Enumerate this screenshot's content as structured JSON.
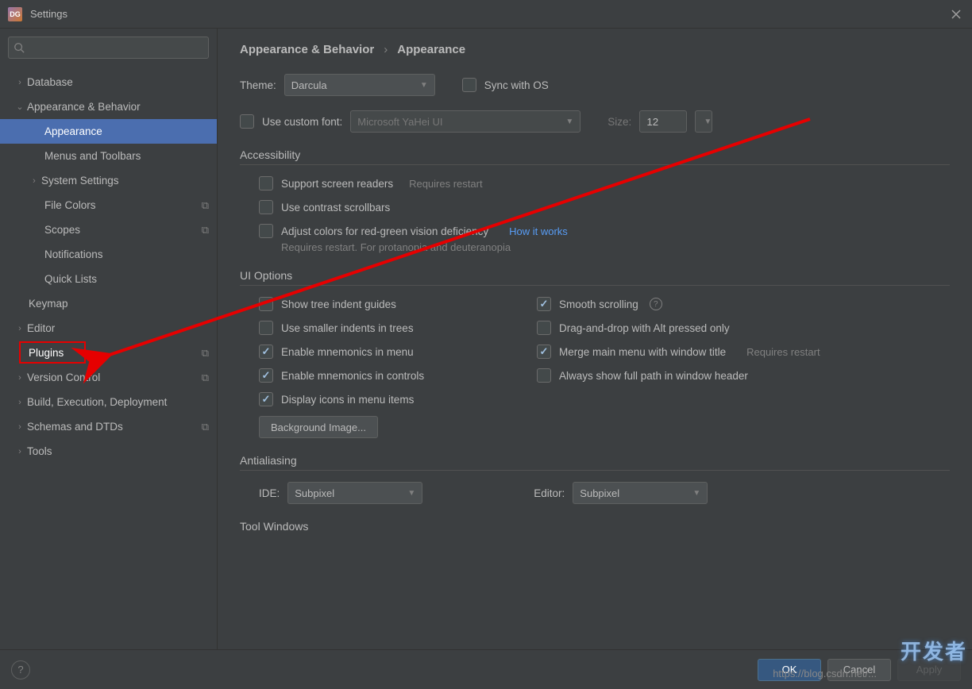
{
  "window": {
    "title": "Settings"
  },
  "sidebar": {
    "search_placeholder": "",
    "items": [
      {
        "label": "Database",
        "level": 0,
        "arrow": "›"
      },
      {
        "label": "Appearance & Behavior",
        "level": 0,
        "arrow": "⌄"
      },
      {
        "label": "Appearance",
        "level": 2,
        "selected": true
      },
      {
        "label": "Menus and Toolbars",
        "level": 2
      },
      {
        "label": "System Settings",
        "level": 1,
        "arrow": "›"
      },
      {
        "label": "File Colors",
        "level": 2,
        "badge": "⧉"
      },
      {
        "label": "Scopes",
        "level": 2,
        "badge": "⧉"
      },
      {
        "label": "Notifications",
        "level": 2
      },
      {
        "label": "Quick Lists",
        "level": 2
      },
      {
        "label": "Keymap",
        "level": 0
      },
      {
        "label": "Editor",
        "level": 0,
        "arrow": "›"
      },
      {
        "label": "Plugins",
        "level": 0,
        "badge": "⧉",
        "highlighted": true
      },
      {
        "label": "Version Control",
        "level": 0,
        "arrow": "›",
        "badge": "⧉"
      },
      {
        "label": "Build, Execution, Deployment",
        "level": 0,
        "arrow": "›"
      },
      {
        "label": "Schemas and DTDs",
        "level": 0,
        "arrow": "›",
        "badge": "⧉"
      },
      {
        "label": "Tools",
        "level": 0,
        "arrow": "›"
      }
    ]
  },
  "breadcrumb": {
    "root": "Appearance & Behavior",
    "sep": "›",
    "leaf": "Appearance"
  },
  "theme": {
    "label": "Theme:",
    "value": "Darcula",
    "sync_label": "Sync with OS",
    "sync_checked": false
  },
  "font": {
    "custom_label": "Use custom font:",
    "custom_checked": false,
    "font_value": "Microsoft YaHei UI",
    "size_label": "Size:",
    "size_value": "12"
  },
  "accessibility": {
    "header": "Accessibility",
    "screen_readers": {
      "label": "Support screen readers",
      "hint": "Requires restart",
      "checked": false
    },
    "contrast": {
      "label": "Use contrast scrollbars",
      "checked": false
    },
    "color_def": {
      "label": "Adjust colors for red-green vision deficiency",
      "link": "How it works",
      "sub": "Requires restart. For protanopia and deuteranopia",
      "checked": false
    }
  },
  "ui_options": {
    "header": "UI Options",
    "left": [
      {
        "label": "Show tree indent guides",
        "checked": false
      },
      {
        "label": "Use smaller indents in trees",
        "checked": false
      },
      {
        "label": "Enable mnemonics in menu",
        "checked": true
      },
      {
        "label": "Enable mnemonics in controls",
        "checked": true
      },
      {
        "label": "Display icons in menu items",
        "checked": true
      }
    ],
    "right": [
      {
        "label": "Smooth scrolling",
        "checked": true,
        "info": true
      },
      {
        "label": "Drag-and-drop with Alt pressed only",
        "checked": false
      },
      {
        "label": "Merge main menu with window title",
        "checked": true,
        "hint": "Requires restart"
      },
      {
        "label": "Always show full path in window header",
        "checked": false
      }
    ],
    "bg_button": "Background Image..."
  },
  "antialiasing": {
    "header": "Antialiasing",
    "ide_label": "IDE:",
    "ide_value": "Subpixel",
    "editor_label": "Editor:",
    "editor_value": "Subpixel"
  },
  "tool_windows": {
    "header": "Tool Windows"
  },
  "footer": {
    "ok": "OK",
    "cancel": "Cancel",
    "apply": "Apply"
  },
  "watermark": "开发者",
  "url_overlay": "https://blog.csdn.net/..."
}
